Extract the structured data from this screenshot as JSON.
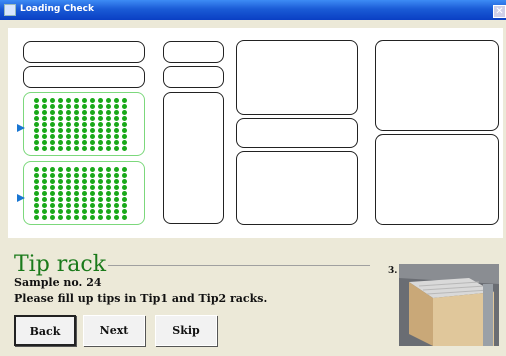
{
  "window": {
    "title": "Loading Check",
    "close_symbol": "✕"
  },
  "section": {
    "title": "Tip rack"
  },
  "sample_label": "Sample no. 24",
  "instruction": "Please fill up tips in Tip1 and Tip2 racks.",
  "buttons": {
    "back": "Back",
    "next": "Next",
    "skip": "Skip"
  },
  "step_label": "3.",
  "colors": {
    "accent": "#1976d2",
    "active_slot": "#7cd87c",
    "tip": "#19a819",
    "section_title": "#1a7a1a"
  }
}
